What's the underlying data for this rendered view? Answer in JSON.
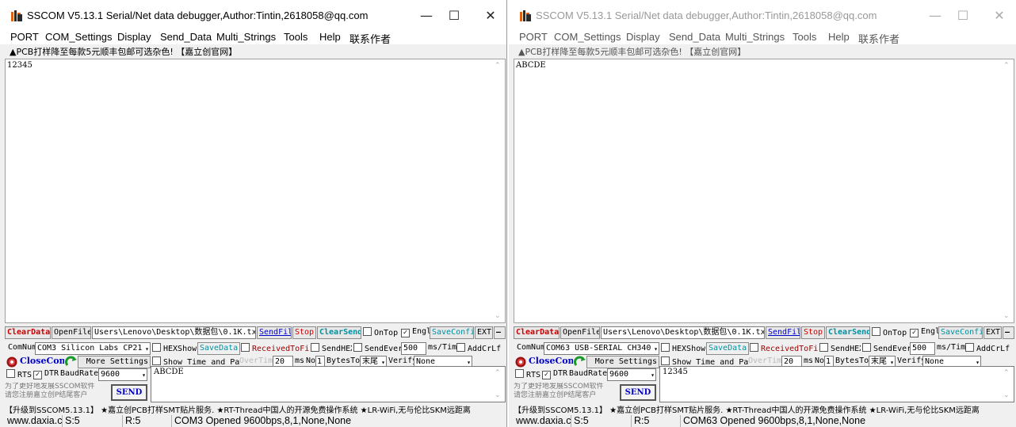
{
  "windows": [
    {
      "title": "SSCOM V5.13.1 Serial/Net data debugger,Author:Tintin,2618058@qq.com",
      "menu": [
        "PORT",
        "COM_Settings",
        "Display",
        "Send_Data",
        "Multi_Strings",
        "Tools",
        "Help",
        "联系作者"
      ],
      "promo": "▲PCB打样降至每款5元顺丰包邮可选杂色! 【嘉立创官网】",
      "receive_text": "12345",
      "toolbar": {
        "clear_data": "ClearData",
        "open_file": "OpenFile",
        "file_path": "Users\\Lenovo\\Desktop\\数据包\\0.1K.txt",
        "send_file": "SendFile",
        "stop": "Stop",
        "clear_send": "ClearSend",
        "on_top": "OnTop",
        "english": "English",
        "save_config": "SaveConfig",
        "ext": "EXT",
        "dash": "—"
      },
      "com_row": {
        "com_num_label": "ComNum",
        "port": "COM3 Silicon Labs CP21",
        "more_settings": "More Settings",
        "hex_show": "HEXShow",
        "save_data": "SaveData",
        "received_to_file": "ReceivedToFile",
        "send_hex": "SendHEX",
        "send_every": "SendEvery",
        "interval": "500",
        "interval_unit": "ms/Tim",
        "add_crlf": "AddCrLf"
      },
      "open_row": {
        "close_com": "CloseCom",
        "show_time": "Show Time and Packe",
        "overtime": "OverTime",
        "overtime_value": "20",
        "ms": "ms",
        "no": "No",
        "bytes_value": "1",
        "bytes_label": "BytesTo",
        "end_select": "末尾",
        "verify": "Verify",
        "verify_value": "None"
      },
      "rts_row": {
        "rts": "RTS",
        "dtr": "DTR",
        "baud_label": "BaudRate",
        "baud_value": "9600"
      },
      "send_text": "ABCDE",
      "ad": "为了更好地发展SSCOM软件\n请您注册嘉立创P结尾客户",
      "send_button": "SEND",
      "ticker": "【升级到SSCOM5.13.1】 ★嘉立创PCB打样SMT贴片服务.   ★RT-Thread中国人的开源免费操作系统   ★LR-WiFi,无与伦比SKM远距离",
      "status": {
        "site": "www.daxia.com",
        "s": "S:5",
        "r": "R:5",
        "port_status": "COM3 Opened  9600bps,8,1,None,None"
      },
      "active": true
    },
    {
      "title": "SSCOM V5.13.1 Serial/Net data debugger,Author:Tintin,2618058@qq.com",
      "menu": [
        "PORT",
        "COM_Settings",
        "Display",
        "Send_Data",
        "Multi_Strings",
        "Tools",
        "Help",
        "联系作者"
      ],
      "promo": "▲PCB打样降至每款5元顺丰包邮可选杂色! 【嘉立创官网】",
      "receive_text": "ABCDE",
      "toolbar": {
        "clear_data": "ClearData",
        "open_file": "OpenFile",
        "file_path": "Users\\Lenovo\\Desktop\\数据包\\0.1K.txt",
        "send_file": "SendFile",
        "stop": "Stop",
        "clear_send": "ClearSend",
        "on_top": "OnTop",
        "english": "English",
        "save_config": "SaveConfig",
        "ext": "EXT",
        "dash": "—"
      },
      "com_row": {
        "com_num_label": "ComNum",
        "port": "COM63 USB-SERIAL CH340",
        "more_settings": "More Settings",
        "hex_show": "HEXShow",
        "save_data": "SaveData",
        "received_to_file": "ReceivedToFile",
        "send_hex": "SendHEX",
        "send_every": "SendEvery",
        "interval": "500",
        "interval_unit": "ms/Tim",
        "add_crlf": "AddCrLf"
      },
      "open_row": {
        "close_com": "CloseCom",
        "show_time": "Show Time and Packe",
        "overtime": "OverTime",
        "overtime_value": "20",
        "ms": "ms",
        "no": "No",
        "bytes_value": "1",
        "bytes_label": "BytesTo",
        "end_select": "末尾",
        "verify": "Verify",
        "verify_value": "None"
      },
      "rts_row": {
        "rts": "RTS",
        "dtr": "DTR",
        "baud_label": "BaudRate",
        "baud_value": "9600"
      },
      "send_text": "12345",
      "ad": "为了更好地发展SSCOM软件\n请您注册嘉立创P结尾客户",
      "send_button": "SEND",
      "ticker": "【升级到SSCOM5.13.1】 ★嘉立创PCB打样SMT贴片服务.   ★RT-Thread中国人的开源免费操作系统   ★LR-WiFi,无与伦比SKM远距离",
      "status": {
        "site": "www.daxia.com",
        "s": "S:5",
        "r": "R:5",
        "port_status": "COM63 Opened  9600bps,8,1,None,None"
      },
      "active": false
    }
  ],
  "controls": {
    "minimize": "—",
    "maximize": "☐",
    "close": "✕"
  },
  "colors": {
    "accent_blue": "#0000c8",
    "clear_red": "#c80000",
    "save_teal": "#0090a0"
  },
  "icons": [
    "app-logo-icon",
    "record-icon",
    "refresh-arrow-icon"
  ]
}
